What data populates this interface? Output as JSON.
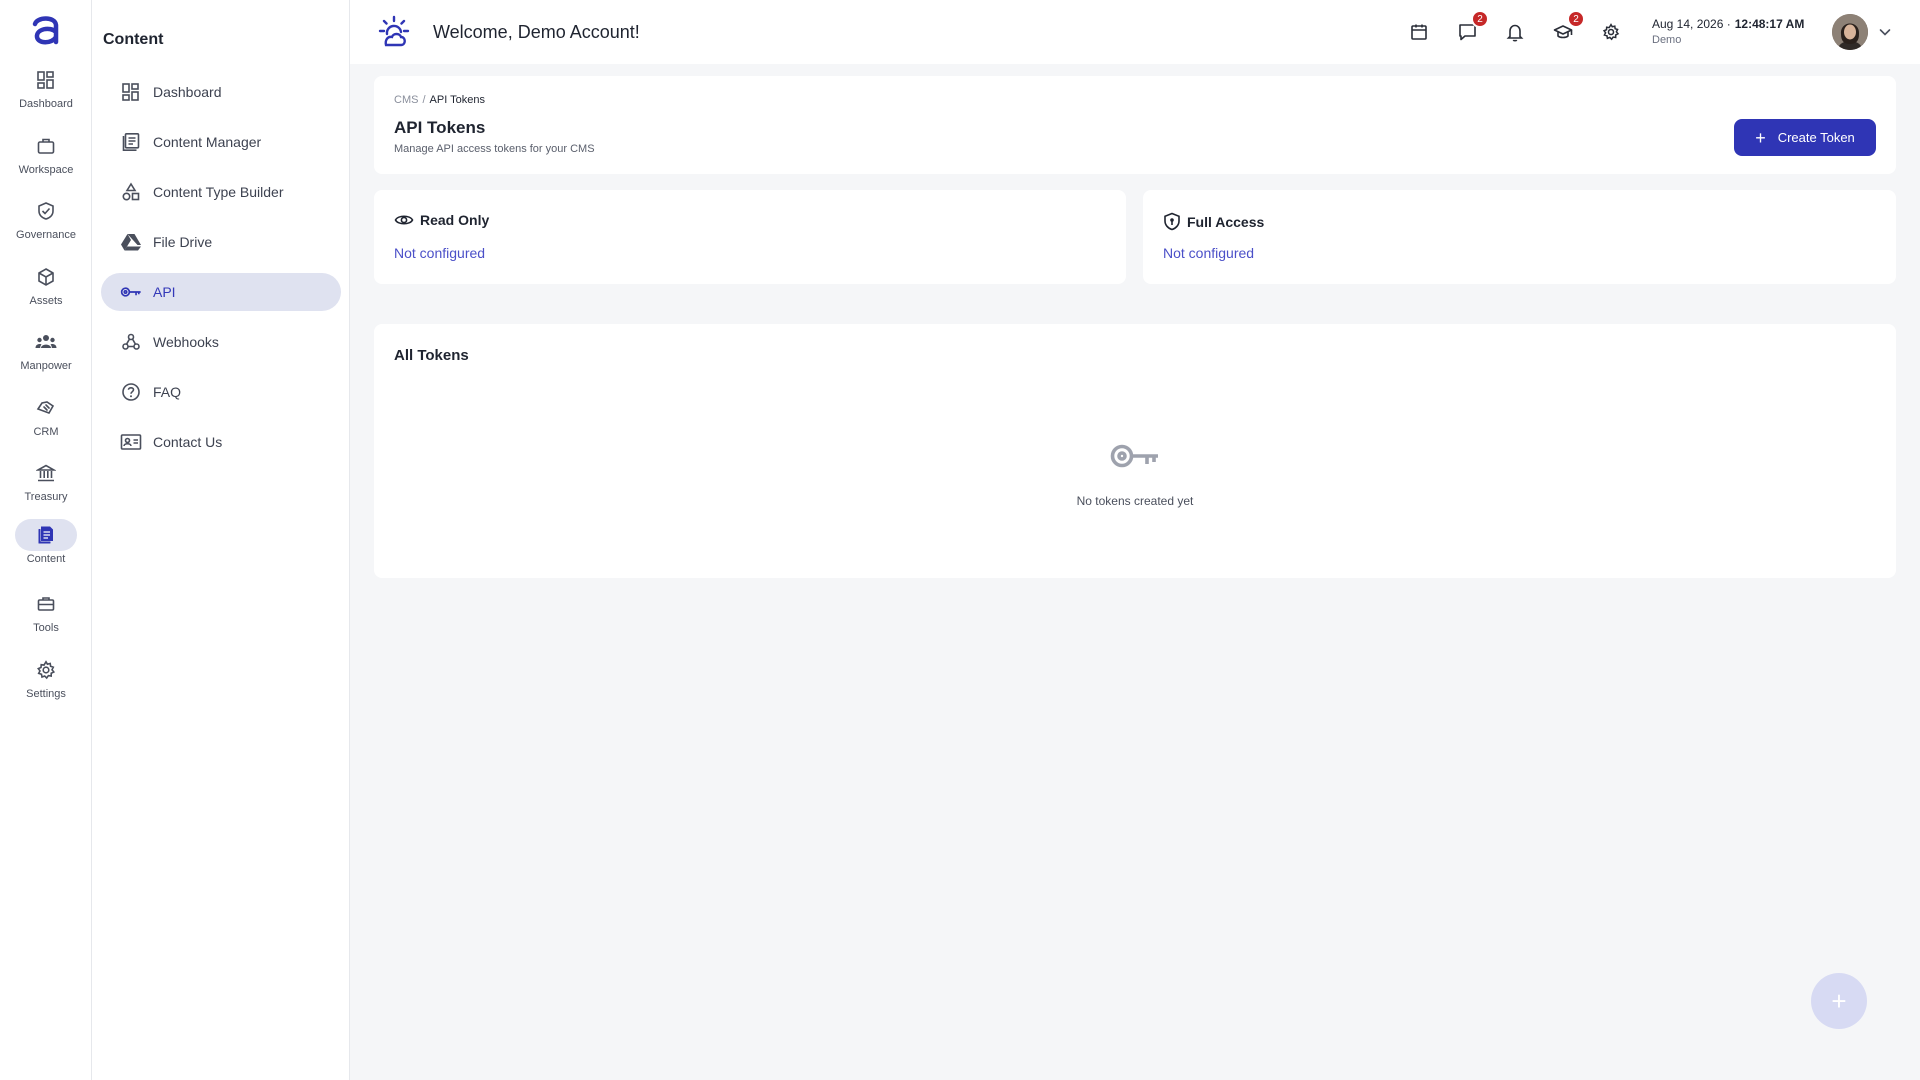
{
  "rail": {
    "items": [
      {
        "label": "Dashboard",
        "icon": "dashboard-icon"
      },
      {
        "label": "Workspace",
        "icon": "briefcase-icon"
      },
      {
        "label": "Governance",
        "icon": "shield-check-icon"
      },
      {
        "label": "Assets",
        "icon": "cube-icon"
      },
      {
        "label": "Manpower",
        "icon": "people-icon"
      },
      {
        "label": "CRM",
        "icon": "handshake-icon"
      },
      {
        "label": "Treasury",
        "icon": "bank-icon"
      },
      {
        "label": "Content",
        "icon": "document-icon"
      },
      {
        "label": "Tools",
        "icon": "toolbox-icon"
      },
      {
        "label": "Settings",
        "icon": "gear-icon"
      }
    ],
    "active": "Content"
  },
  "subnav": {
    "title": "Content",
    "items": [
      {
        "label": "Dashboard",
        "icon": "dashboard-icon"
      },
      {
        "label": "Content Manager",
        "icon": "list-doc-icon"
      },
      {
        "label": "Content Type Builder",
        "icon": "shapes-icon"
      },
      {
        "label": "File Drive",
        "icon": "drive-icon"
      },
      {
        "label": "API",
        "icon": "key-icon"
      },
      {
        "label": "Webhooks",
        "icon": "webhook-icon"
      },
      {
        "label": "FAQ",
        "icon": "help-circle-icon"
      },
      {
        "label": "Contact Us",
        "icon": "contact-card-icon"
      }
    ],
    "active": "API"
  },
  "topbar": {
    "welcome": "Welcome, Demo Account!",
    "messages_badge": "2",
    "learning_badge": "2",
    "date": "Aug 14, 2026 ·",
    "time": "12:48:17 AM",
    "account": "Demo"
  },
  "header": {
    "breadcrumb_root": "CMS",
    "breadcrumb_sep": "/",
    "breadcrumb_current": "API Tokens",
    "title": "API Tokens",
    "subtitle": "Manage API access tokens for your CMS",
    "create_label": "Create Token"
  },
  "access": {
    "read_only": {
      "title": "Read Only",
      "status": "Not configured"
    },
    "full_access": {
      "title": "Full Access",
      "status": "Not configured"
    }
  },
  "tokens": {
    "title": "All Tokens",
    "empty_text": "No tokens created yet"
  },
  "colors": {
    "accent": "#2f35b5",
    "link": "#4b50c8",
    "badge": "#c62828",
    "active_bg": "#dfe2f0"
  }
}
